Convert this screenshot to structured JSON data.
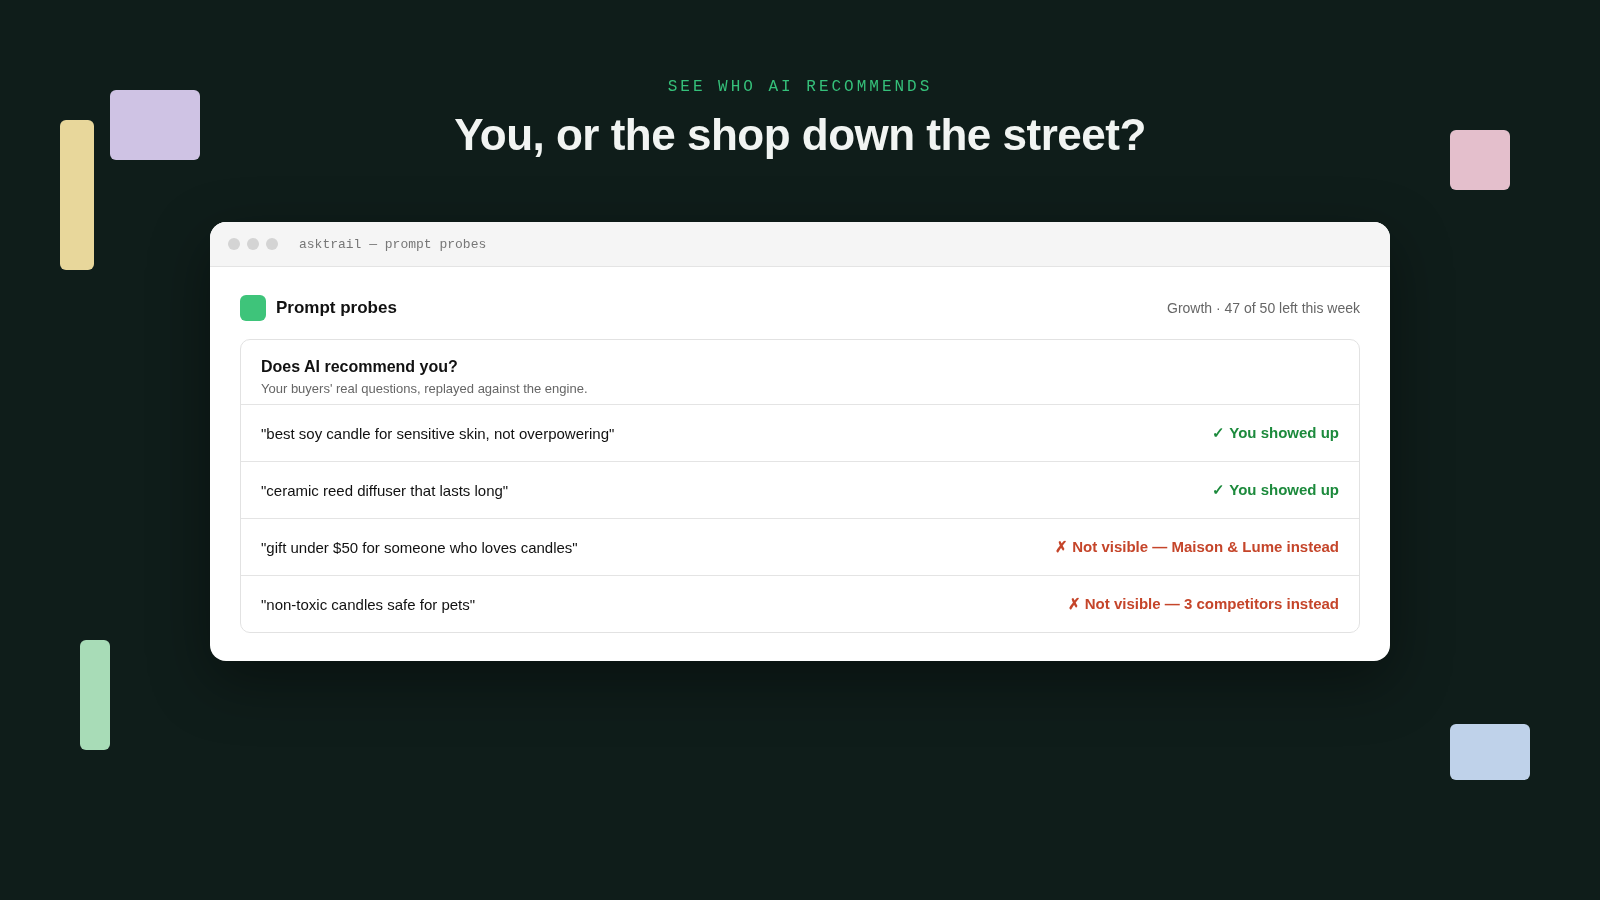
{
  "kicker": "SEE WHO AI RECOMMENDS",
  "headline": "You, or the shop down the street?",
  "window": {
    "title": "asktrail — prompt probes"
  },
  "panel": {
    "title": "Prompt probes",
    "plan": "Growth · 47 of 50 left this week"
  },
  "card": {
    "title": "Does AI recommend you?",
    "subtitle": "Your buyers' real questions, replayed against the engine."
  },
  "probes": [
    {
      "query": "\"best soy candle for sensitive skin, not overpowering\"",
      "kind": "hit",
      "result": "✓ You showed up"
    },
    {
      "query": "\"ceramic reed diffuser that lasts long\"",
      "kind": "hit",
      "result": "✓ You showed up"
    },
    {
      "query": "\"gift under $50 for someone who loves candles\"",
      "kind": "miss",
      "result": "✗ Not visible — Maison & Lume instead"
    },
    {
      "query": "\"non-toxic candles safe for pets\"",
      "kind": "miss",
      "result": "✗ Not visible — 3 competitors instead"
    }
  ]
}
